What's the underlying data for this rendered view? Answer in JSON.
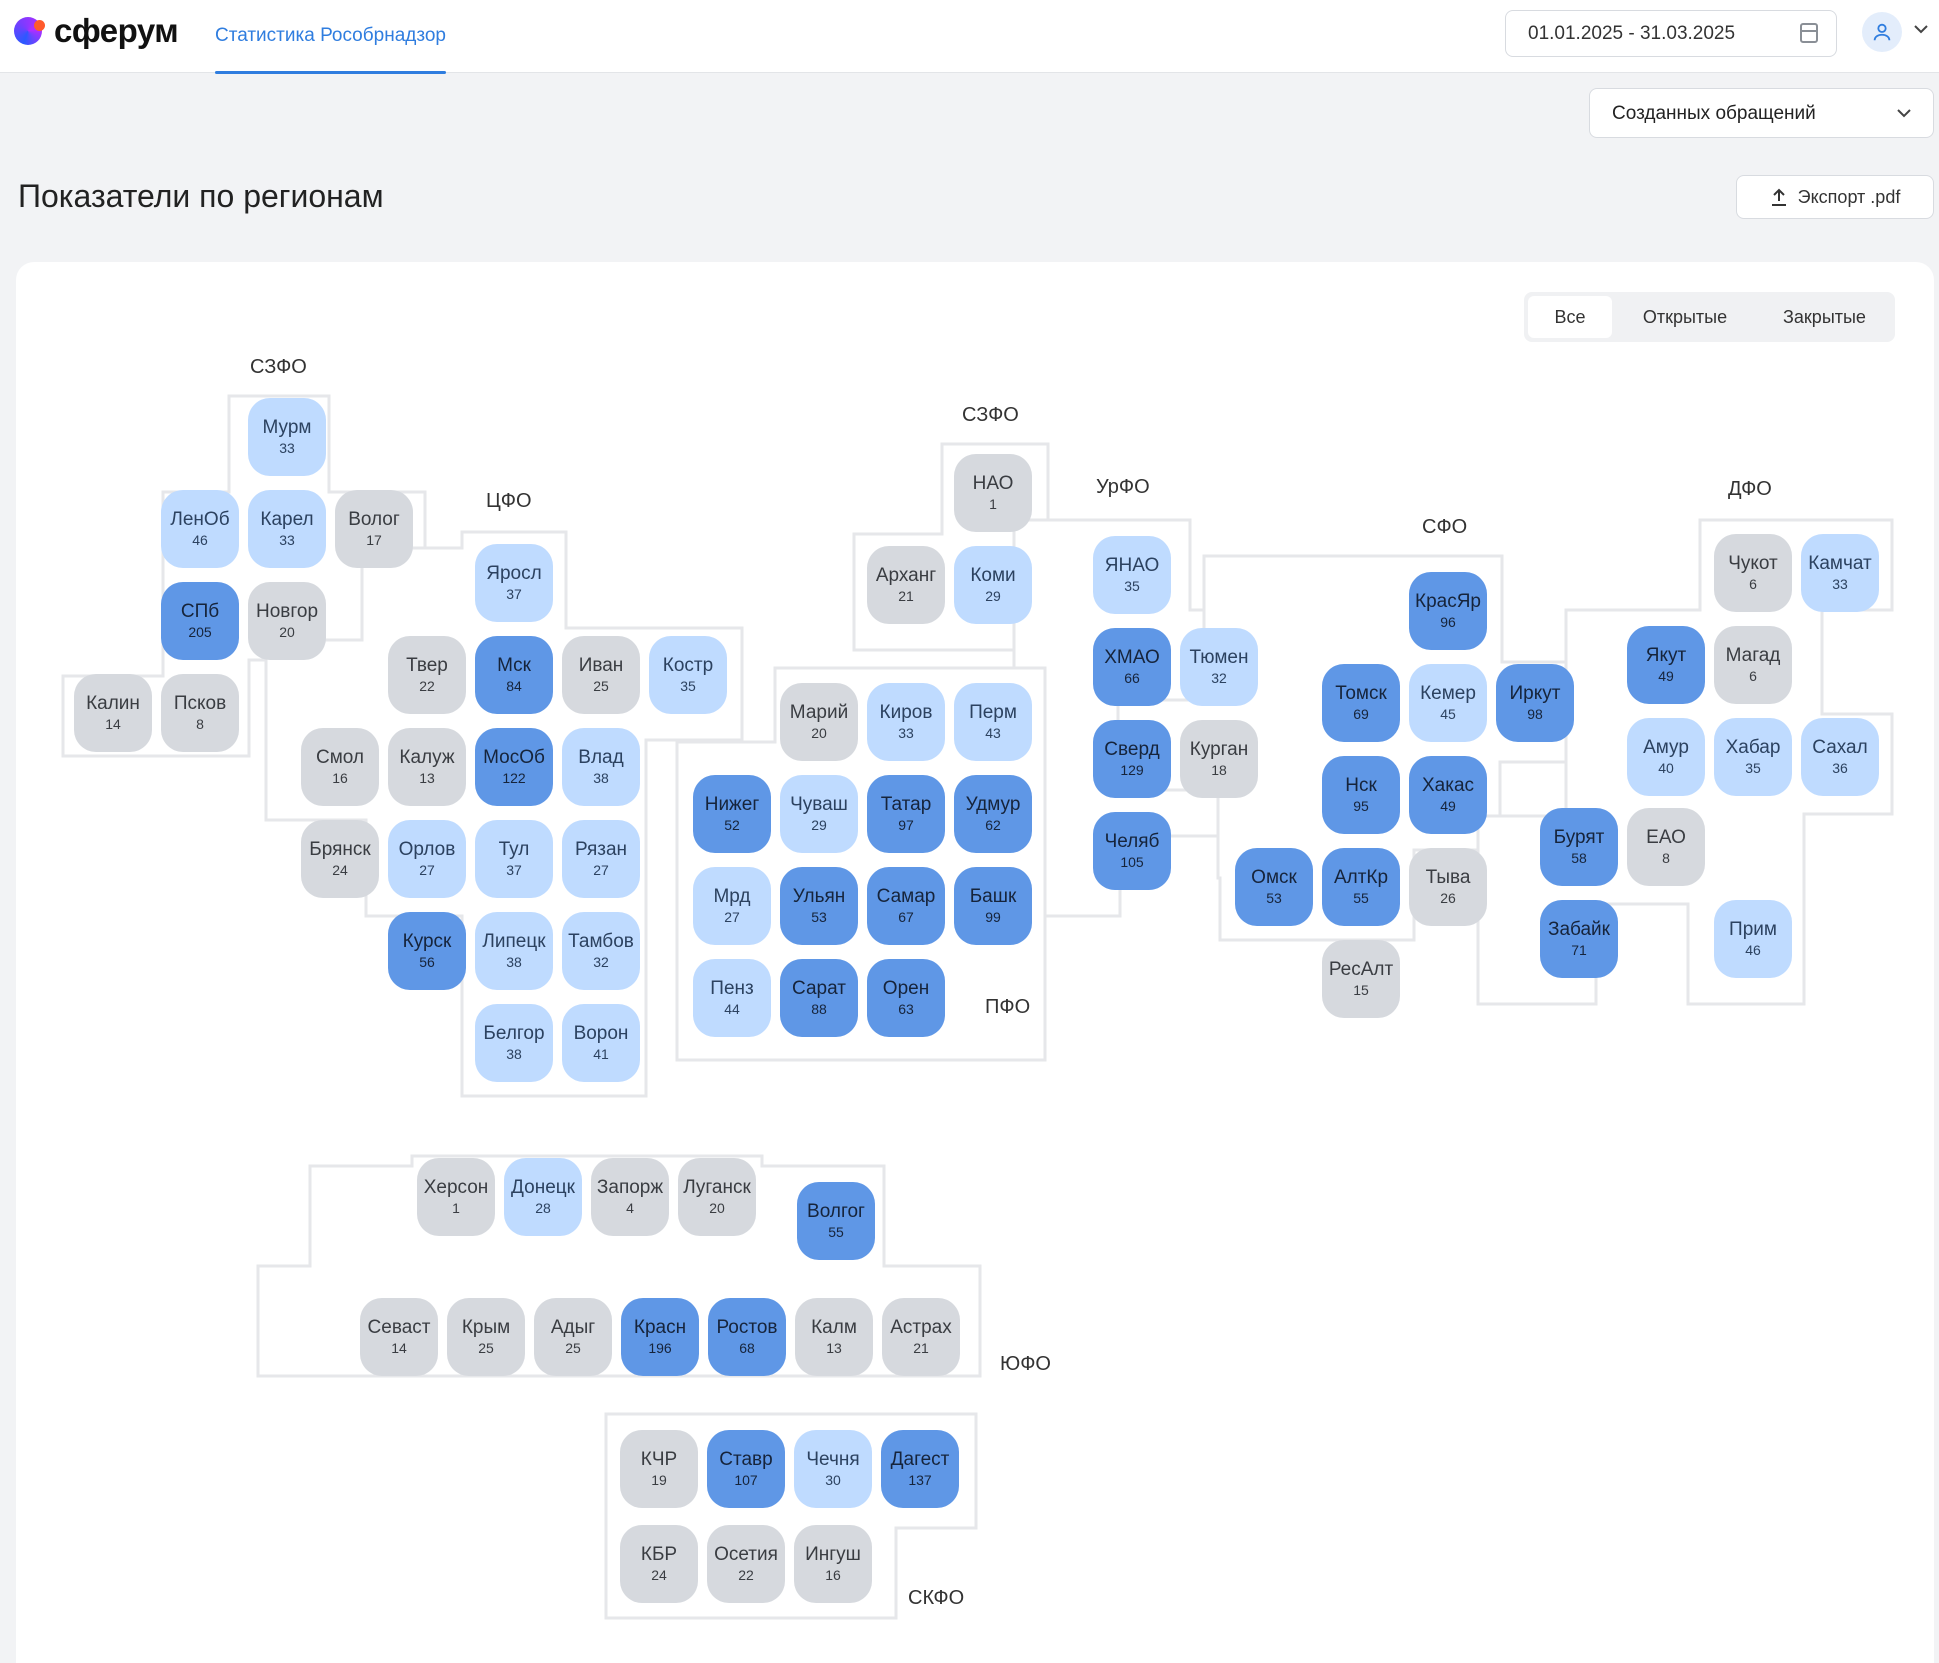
{
  "header": {
    "logo_text": "сферум",
    "nav_tab": "Статистика Рособрнадзор",
    "date_range": "01.01.2025 - 31.03.2025"
  },
  "dropdown": {
    "selected": "Созданных обращений"
  },
  "page": {
    "title": "Показатели по регионам",
    "export_label": "Экспорт .pdf"
  },
  "filters": {
    "all": "Все",
    "open": "Открытые",
    "closed": "Закрытые",
    "active": "all"
  },
  "palette": {
    "c0": "#d6d9de",
    "c1": "#bfdbff",
    "c2": "#85b3f0",
    "c3": "#5f97e6"
  },
  "district_labels": [
    {
      "id": "szfo1",
      "text": "СЗФО"
    },
    {
      "id": "cfo",
      "text": "ЦФО"
    },
    {
      "id": "szfo2",
      "text": "СЗФО"
    },
    {
      "id": "urfo",
      "text": "УрФО"
    },
    {
      "id": "sfo",
      "text": "СФО"
    },
    {
      "id": "dfo",
      "text": "ДФО"
    },
    {
      "id": "pfo",
      "text": "ПФО"
    },
    {
      "id": "yufo",
      "text": "ЮФО"
    },
    {
      "id": "skfo",
      "text": "СКФО"
    }
  ],
  "regions": [
    {
      "name": "Мурм",
      "value": 33
    },
    {
      "name": "ЛенОб",
      "value": 46
    },
    {
      "name": "Карел",
      "value": 33
    },
    {
      "name": "Волог",
      "value": 17
    },
    {
      "name": "СПб",
      "value": 205
    },
    {
      "name": "Новгор",
      "value": 20
    },
    {
      "name": "Калин",
      "value": 14
    },
    {
      "name": "Псков",
      "value": 8
    },
    {
      "name": "Яросл",
      "value": 37
    },
    {
      "name": "Твер",
      "value": 22
    },
    {
      "name": "Мск",
      "value": 84
    },
    {
      "name": "Иван",
      "value": 25
    },
    {
      "name": "Костр",
      "value": 35
    },
    {
      "name": "Смол",
      "value": 16
    },
    {
      "name": "Калуж",
      "value": 13
    },
    {
      "name": "МосОб",
      "value": 122
    },
    {
      "name": "Влад",
      "value": 38
    },
    {
      "name": "Брянск",
      "value": 24
    },
    {
      "name": "Орлов",
      "value": 27
    },
    {
      "name": "Тул",
      "value": 37
    },
    {
      "name": "Рязан",
      "value": 27
    },
    {
      "name": "Курск",
      "value": 56
    },
    {
      "name": "Липецк",
      "value": 38
    },
    {
      "name": "Тамбов",
      "value": 32
    },
    {
      "name": "Белгор",
      "value": 38
    },
    {
      "name": "Ворон",
      "value": 41
    },
    {
      "name": "НАО",
      "value": 1
    },
    {
      "name": "Арханг",
      "value": 21
    },
    {
      "name": "Коми",
      "value": 29
    },
    {
      "name": "Марий",
      "value": 20
    },
    {
      "name": "Киров",
      "value": 33
    },
    {
      "name": "Перм",
      "value": 43
    },
    {
      "name": "Нижег",
      "value": 52
    },
    {
      "name": "Чуваш",
      "value": 29
    },
    {
      "name": "Татар",
      "value": 97
    },
    {
      "name": "Удмур",
      "value": 62
    },
    {
      "name": "Мрд",
      "value": 27
    },
    {
      "name": "Ульян",
      "value": 53
    },
    {
      "name": "Самар",
      "value": 67
    },
    {
      "name": "Башк",
      "value": 99
    },
    {
      "name": "Пенз",
      "value": 44
    },
    {
      "name": "Сарат",
      "value": 88
    },
    {
      "name": "Орен",
      "value": 63
    },
    {
      "name": "ЯНАО",
      "value": 35
    },
    {
      "name": "ХМАО",
      "value": 66
    },
    {
      "name": "Тюмен",
      "value": 32
    },
    {
      "name": "Сверд",
      "value": 129
    },
    {
      "name": "Курган",
      "value": 18
    },
    {
      "name": "Челяб",
      "value": 105
    },
    {
      "name": "КрасЯр",
      "value": 96
    },
    {
      "name": "Томск",
      "value": 69
    },
    {
      "name": "Кемер",
      "value": 45
    },
    {
      "name": "Иркут",
      "value": 98
    },
    {
      "name": "Нск",
      "value": 95
    },
    {
      "name": "Хакас",
      "value": 49
    },
    {
      "name": "Омск",
      "value": 53
    },
    {
      "name": "АлтКр",
      "value": 55
    },
    {
      "name": "Тыва",
      "value": 26
    },
    {
      "name": "РесАлт",
      "value": 15
    },
    {
      "name": "Чукот",
      "value": 6
    },
    {
      "name": "Камчат",
      "value": 33
    },
    {
      "name": "Якут",
      "value": 49
    },
    {
      "name": "Магад",
      "value": 6
    },
    {
      "name": "Амур",
      "value": 40
    },
    {
      "name": "Хабар",
      "value": 35
    },
    {
      "name": "Сахал",
      "value": 36
    },
    {
      "name": "Бурят",
      "value": 58
    },
    {
      "name": "ЕАО",
      "value": 8
    },
    {
      "name": "Забайк",
      "value": 71
    },
    {
      "name": "Прим",
      "value": 46
    },
    {
      "name": "Херсон",
      "value": 1
    },
    {
      "name": "Донецк",
      "value": 28
    },
    {
      "name": "Запорж",
      "value": 4
    },
    {
      "name": "Луганск",
      "value": 20
    },
    {
      "name": "Волгог",
      "value": 55
    },
    {
      "name": "Севаст",
      "value": 14
    },
    {
      "name": "Крым",
      "value": 25
    },
    {
      "name": "Адыг",
      "value": 25
    },
    {
      "name": "Красн",
      "value": 196
    },
    {
      "name": "Ростов",
      "value": 68
    },
    {
      "name": "Калм",
      "value": 13
    },
    {
      "name": "Астрах",
      "value": 21
    },
    {
      "name": "КЧР",
      "value": 19
    },
    {
      "name": "Ставр",
      "value": 107
    },
    {
      "name": "Чечня",
      "value": 30
    },
    {
      "name": "Дагест",
      "value": 137
    },
    {
      "name": "КБР",
      "value": 24
    },
    {
      "name": "Осетия",
      "value": 22
    },
    {
      "name": "Ингуш",
      "value": 16
    }
  ]
}
